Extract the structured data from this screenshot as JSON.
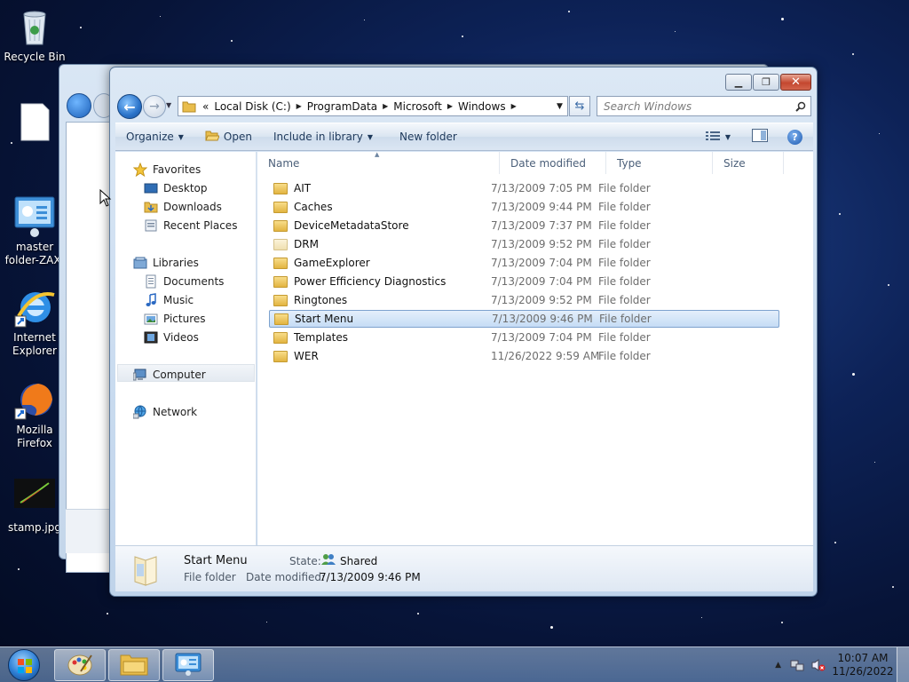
{
  "desktop": {
    "icons": [
      {
        "label": "Recycle Bin"
      },
      {
        "label": ""
      },
      {
        "label": "master folder-ZAX."
      },
      {
        "label": "Internet Explorer"
      },
      {
        "label": "Mozilla Firefox"
      },
      {
        "label": "stamp.jpg"
      }
    ]
  },
  "window": {
    "address": {
      "overflow": "«",
      "crumbs": [
        "Local Disk (C:)",
        "ProgramData",
        "Microsoft",
        "Windows"
      ]
    },
    "search_placeholder": "Search Windows",
    "commands": {
      "organize": "Organize",
      "open": "Open",
      "include": "Include in library",
      "new_folder": "New folder"
    },
    "nav": {
      "favorites": "Favorites",
      "desktop": "Desktop",
      "downloads": "Downloads",
      "recent": "Recent Places",
      "libraries": "Libraries",
      "documents": "Documents",
      "music": "Music",
      "pictures": "Pictures",
      "videos": "Videos",
      "computer": "Computer",
      "network": "Network"
    },
    "columns": {
      "name": "Name",
      "date": "Date modified",
      "type": "Type",
      "size": "Size"
    },
    "files": [
      {
        "name": "AIT",
        "date": "7/13/2009 7:05 PM",
        "type": "File folder"
      },
      {
        "name": "Caches",
        "date": "7/13/2009 9:44 PM",
        "type": "File folder"
      },
      {
        "name": "DeviceMetadataStore",
        "date": "7/13/2009 7:37 PM",
        "type": "File folder"
      },
      {
        "name": "DRM",
        "date": "7/13/2009 9:52 PM",
        "type": "File folder"
      },
      {
        "name": "GameExplorer",
        "date": "7/13/2009 7:04 PM",
        "type": "File folder"
      },
      {
        "name": "Power Efficiency Diagnostics",
        "date": "7/13/2009 7:04 PM",
        "type": "File folder"
      },
      {
        "name": "Ringtones",
        "date": "7/13/2009 9:52 PM",
        "type": "File folder"
      },
      {
        "name": "Start Menu",
        "date": "7/13/2009 9:46 PM",
        "type": "File folder"
      },
      {
        "name": "Templates",
        "date": "7/13/2009 7:04 PM",
        "type": "File folder"
      },
      {
        "name": "WER",
        "date": "11/26/2022 9:59 AM",
        "type": "File folder"
      }
    ],
    "details": {
      "name": "Start Menu",
      "type": "File folder",
      "state_label": "State:",
      "state_value": "Shared",
      "date_label": "Date modified:",
      "date_value": "7/13/2009 9:46 PM"
    }
  },
  "taskbar": {
    "time": "10:07 AM",
    "date": "11/26/2022"
  }
}
